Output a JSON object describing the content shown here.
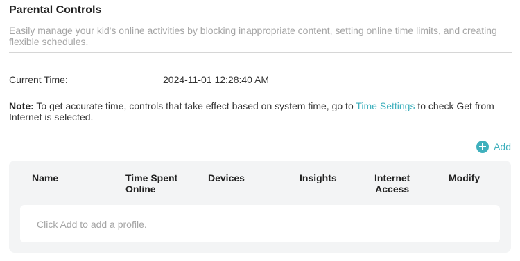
{
  "header": {
    "title": "Parental Controls",
    "description": "Easily manage your kid's online activities by blocking inappropriate content, setting online time limits, and creating flexible schedules."
  },
  "current_time": {
    "label": "Current Time:",
    "value": "2024-11-01 12:28:40 AM"
  },
  "note": {
    "label": "Note:",
    "text_before": " To get accurate time, controls that take effect based on system time, go to ",
    "link": "Time Settings",
    "text_after": " to check Get from Internet is selected."
  },
  "add_button": {
    "icon": "plus-circle-icon",
    "label": "Add"
  },
  "table": {
    "columns": {
      "name": "Name",
      "time_spent_line1": "Time Spent",
      "time_spent_line2": "Online",
      "devices": "Devices",
      "insights": "Insights",
      "internet_line1": "Internet",
      "internet_line2": "Access",
      "modify": "Modify"
    },
    "empty_message": "Click Add to add a profile."
  },
  "colors": {
    "accent": "#3fb0bd",
    "muted_text": "#a5a5a5",
    "card_background": "#f3f4f5"
  }
}
